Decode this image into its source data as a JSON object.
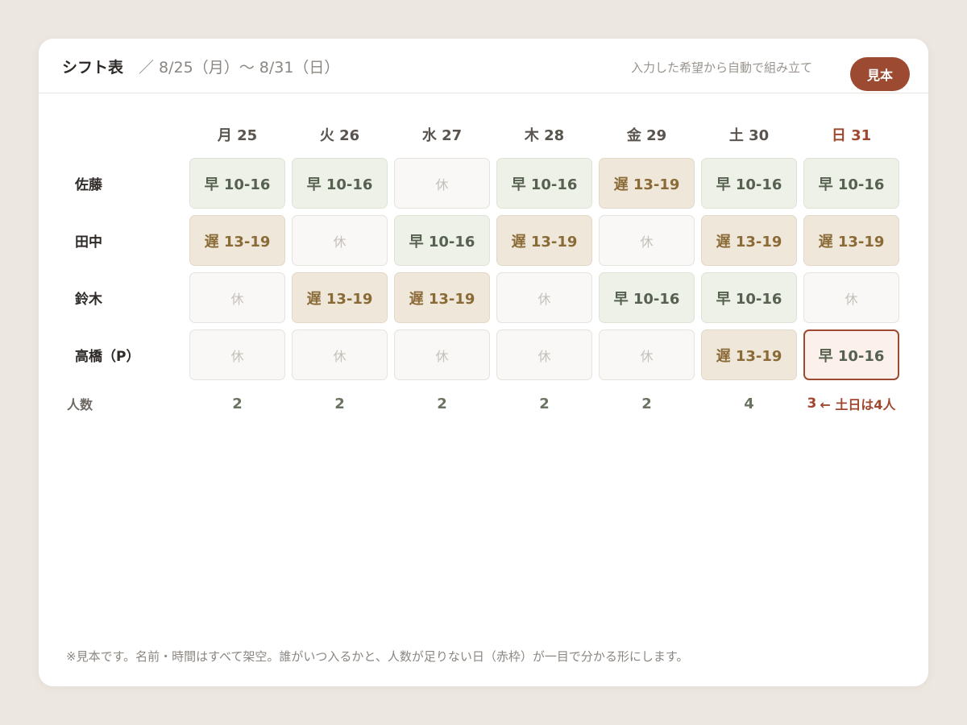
{
  "header": {
    "title": "シフト表",
    "range": "／ 8/25（月）〜 8/31（日）",
    "subtitle": "入力した希望から自動で組み立て",
    "sample_button": "見本"
  },
  "days": [
    "月 25",
    "火 26",
    "水 27",
    "木 28",
    "金 29",
    "土 30",
    "日 31"
  ],
  "staff": [
    {
      "name": "佐藤",
      "shifts": [
        "早 10-16",
        "早 10-16",
        "休",
        "早 10-16",
        "遅 13-19",
        "早 10-16",
        "早 10-16"
      ]
    },
    {
      "name": "田中",
      "shifts": [
        "遅 13-19",
        "休",
        "早 10-16",
        "遅 13-19",
        "休",
        "遅 13-19",
        "遅 13-19"
      ]
    },
    {
      "name": "鈴木",
      "shifts": [
        "休",
        "遅 13-19",
        "遅 13-19",
        "休",
        "早 10-16",
        "早 10-16",
        "休"
      ]
    },
    {
      "name": "高橋（P）",
      "shifts": [
        "休",
        "休",
        "休",
        "休",
        "休",
        "遅 13-19",
        "早 10-16"
      ]
    }
  ],
  "counts": {
    "label": "人数",
    "values": [
      "2",
      "2",
      "2",
      "2",
      "2",
      "4",
      "3"
    ],
    "warning_note": "← 土日は4人"
  },
  "footnote": "※見本です。名前・時間はすべて架空。誰がいつ入るかと、人数が足りない日（赤枠）が一目で分かる形にします。",
  "colors": {
    "accent": "#9c4a32",
    "early_bg": "#edf1e8",
    "late_bg": "#efe7da",
    "off_bg": "#f9f8f6",
    "background": "#ede7e1"
  }
}
